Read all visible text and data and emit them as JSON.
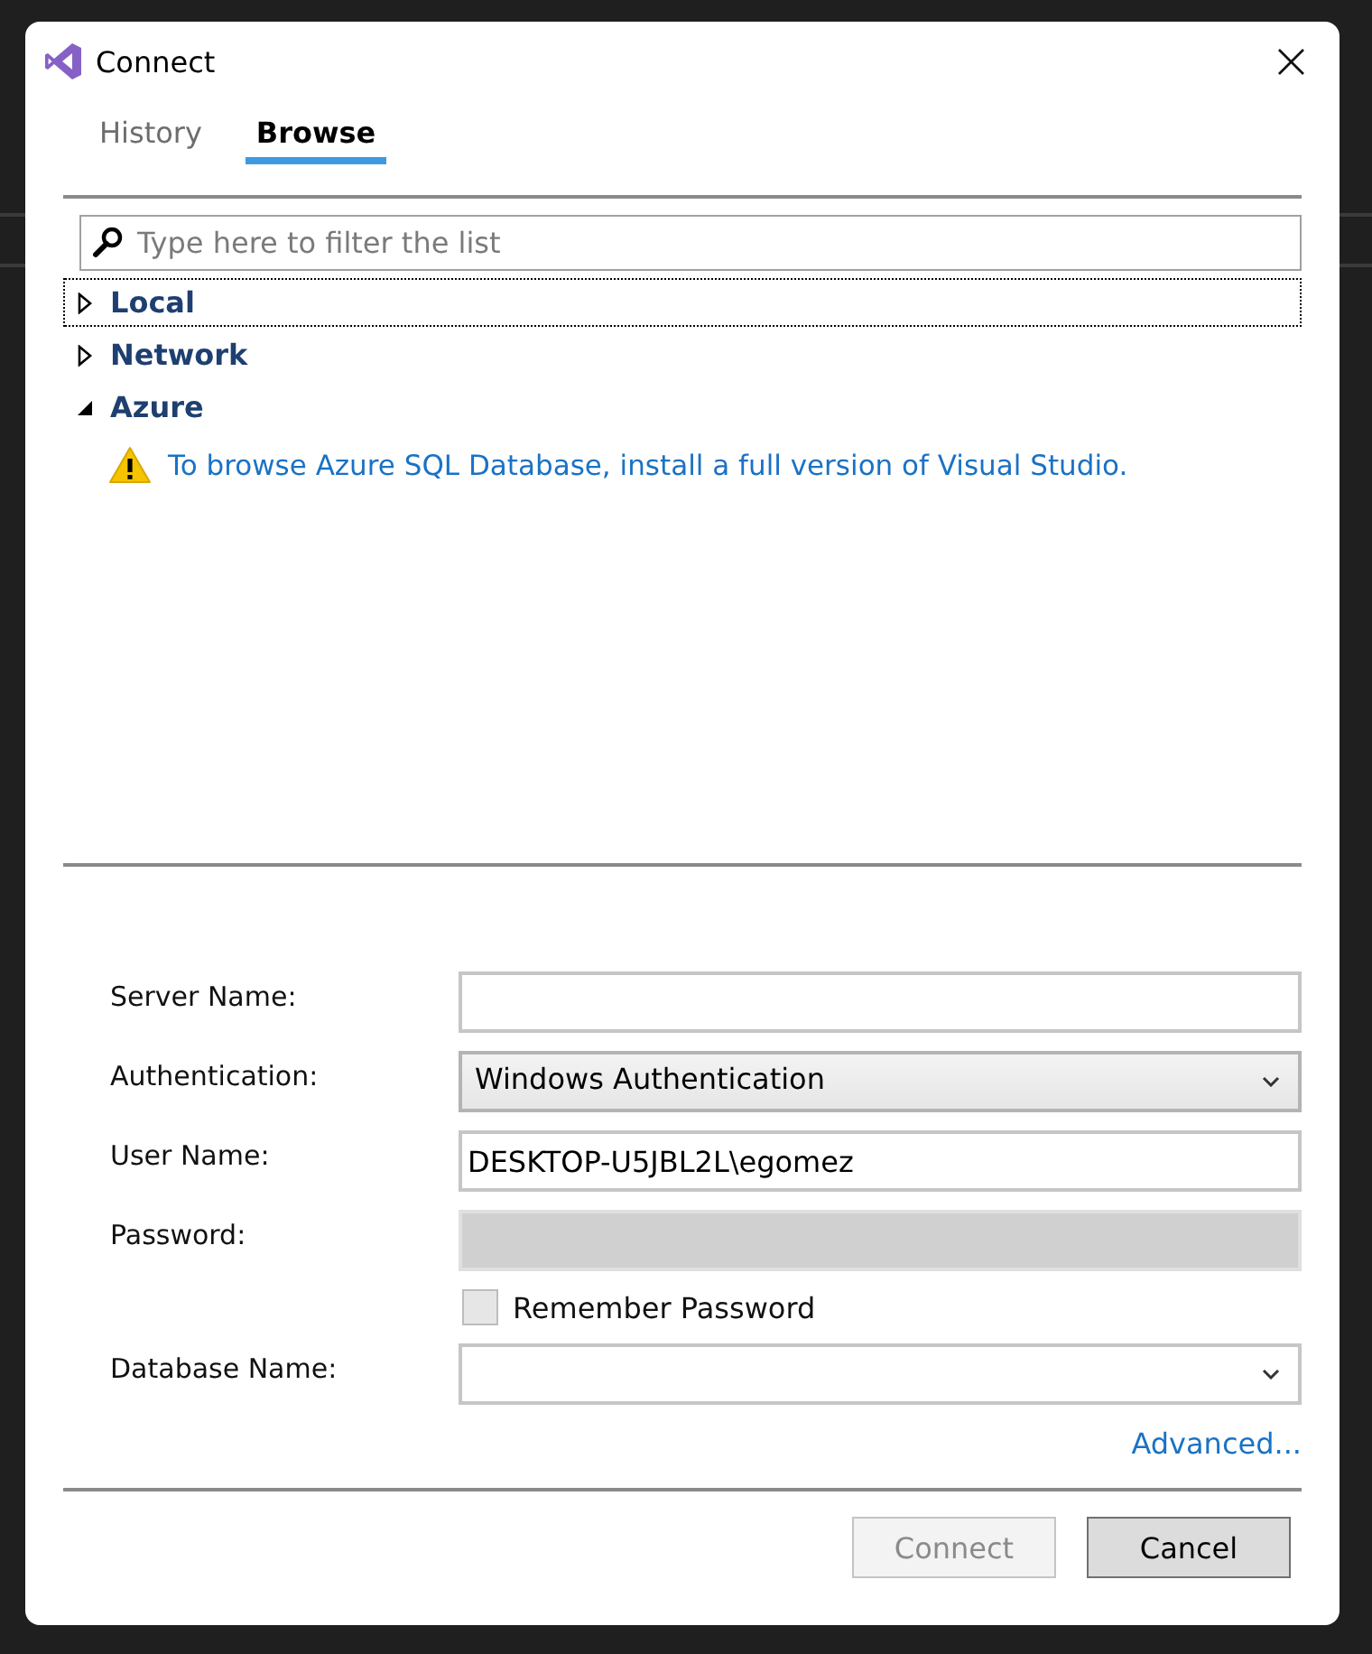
{
  "window": {
    "title": "Connect",
    "close": "×"
  },
  "tabs": [
    {
      "label": "History",
      "selected": false
    },
    {
      "label": "Browse",
      "selected": true
    }
  ],
  "filter": {
    "placeholder": "Type here to filter the list"
  },
  "tree": [
    {
      "label": "Local",
      "expanded": false,
      "focused": true
    },
    {
      "label": "Network",
      "expanded": false,
      "focused": false
    },
    {
      "label": "Azure",
      "expanded": true,
      "focused": false,
      "message": "To browse Azure SQL Database, install a full version of Visual Studio."
    }
  ],
  "form": [
    {
      "kind": "text",
      "label": "Server Name:",
      "disabled": false
    },
    {
      "kind": "select",
      "label": "Authentication:",
      "value": "Windows Authentication",
      "disabled": false
    },
    {
      "kind": "text",
      "label": "User Name:",
      "value": "DESKTOP-U5JBL2L\\egomez",
      "disabled": false
    },
    {
      "kind": "text",
      "label": "Password:",
      "disabled": true
    },
    {
      "kind": "checkbox",
      "label": "Remember Password",
      "checked": false
    },
    {
      "kind": "combo",
      "label": "Database Name:",
      "disabled": false
    }
  ],
  "advanced_link": "Advanced...",
  "buttons": [
    {
      "label": "Connect",
      "disabled": true
    },
    {
      "label": "Cancel",
      "disabled": false
    }
  ]
}
